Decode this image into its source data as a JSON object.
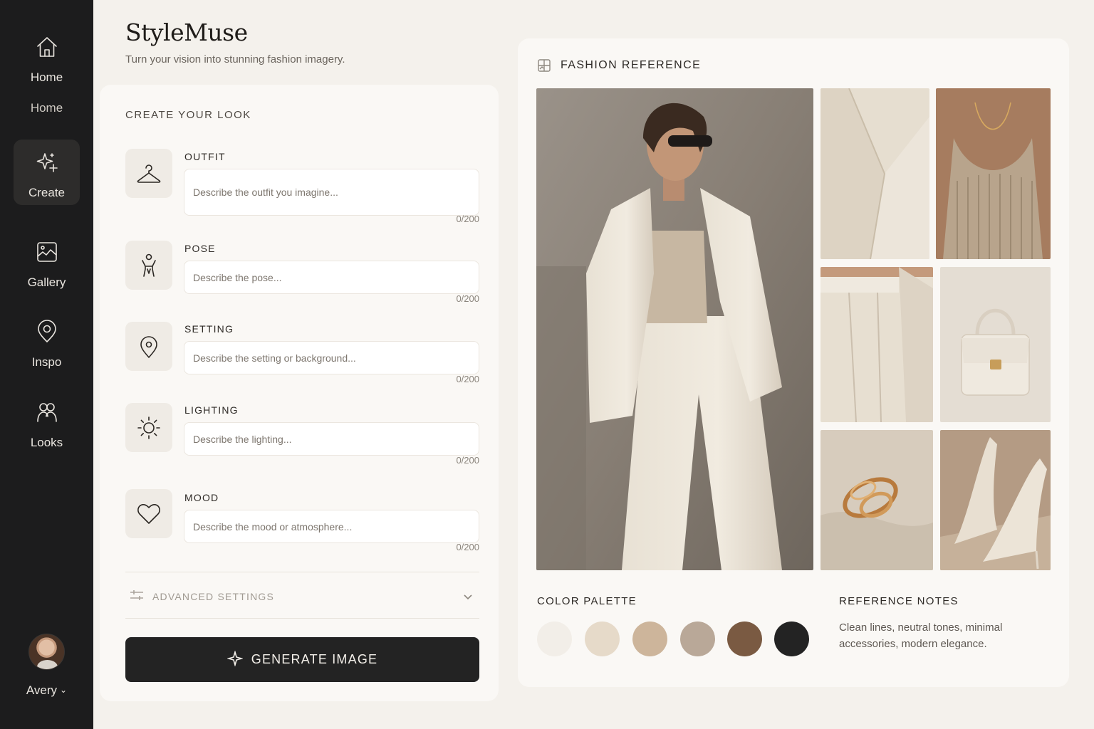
{
  "app": {
    "brand": "StyleMuse",
    "tagline": "Turn your vision into stunning fashion imagery."
  },
  "sidebar": {
    "items": [
      {
        "label": "Home",
        "icon": "home-icon"
      },
      {
        "label": "Create",
        "icon": "sparkle-icon",
        "active": true
      },
      {
        "label": "Gallery",
        "icon": "gallery-icon"
      },
      {
        "label": "Inspo",
        "icon": "location-pin-icon"
      },
      {
        "label": "Looks",
        "icon": "people-icon"
      }
    ],
    "extra_label": "Home",
    "user": {
      "name": "Avery"
    }
  },
  "form": {
    "section_title": "CREATE YOUR LOOK",
    "fields": [
      {
        "label": "OUTFIT",
        "placeholder": "Describe the outfit you imagine...",
        "counter": "0/200",
        "icon": "hanger-icon"
      },
      {
        "label": "POSE",
        "placeholder": "Describe the pose...",
        "counter": "0/200",
        "icon": "person-pose-icon"
      },
      {
        "label": "SETTING",
        "placeholder": "Describe the setting or background...",
        "counter": "0/200",
        "icon": "location-pin-icon"
      },
      {
        "label": "LIGHTING",
        "placeholder": "Describe the lighting...",
        "counter": "0/200",
        "icon": "sun-icon"
      },
      {
        "label": "MOOD",
        "placeholder": "Describe the mood or atmosphere...",
        "counter": "0/200",
        "icon": "heart-icon"
      }
    ],
    "advanced_label": "ADVANCED SETTINGS",
    "generate_label": "GENERATE IMAGE"
  },
  "reference": {
    "title": "FASHION REFERENCE",
    "palette_title": "COLOR PALETTE",
    "palette": [
      "#f2eee8",
      "#e6dac9",
      "#cdb59b",
      "#b9a898",
      "#7a5a42",
      "#232323"
    ],
    "notes_title": "REFERENCE NOTES",
    "notes_text": "Clean lines, neutral tones, minimal accessories, modern elegance."
  }
}
